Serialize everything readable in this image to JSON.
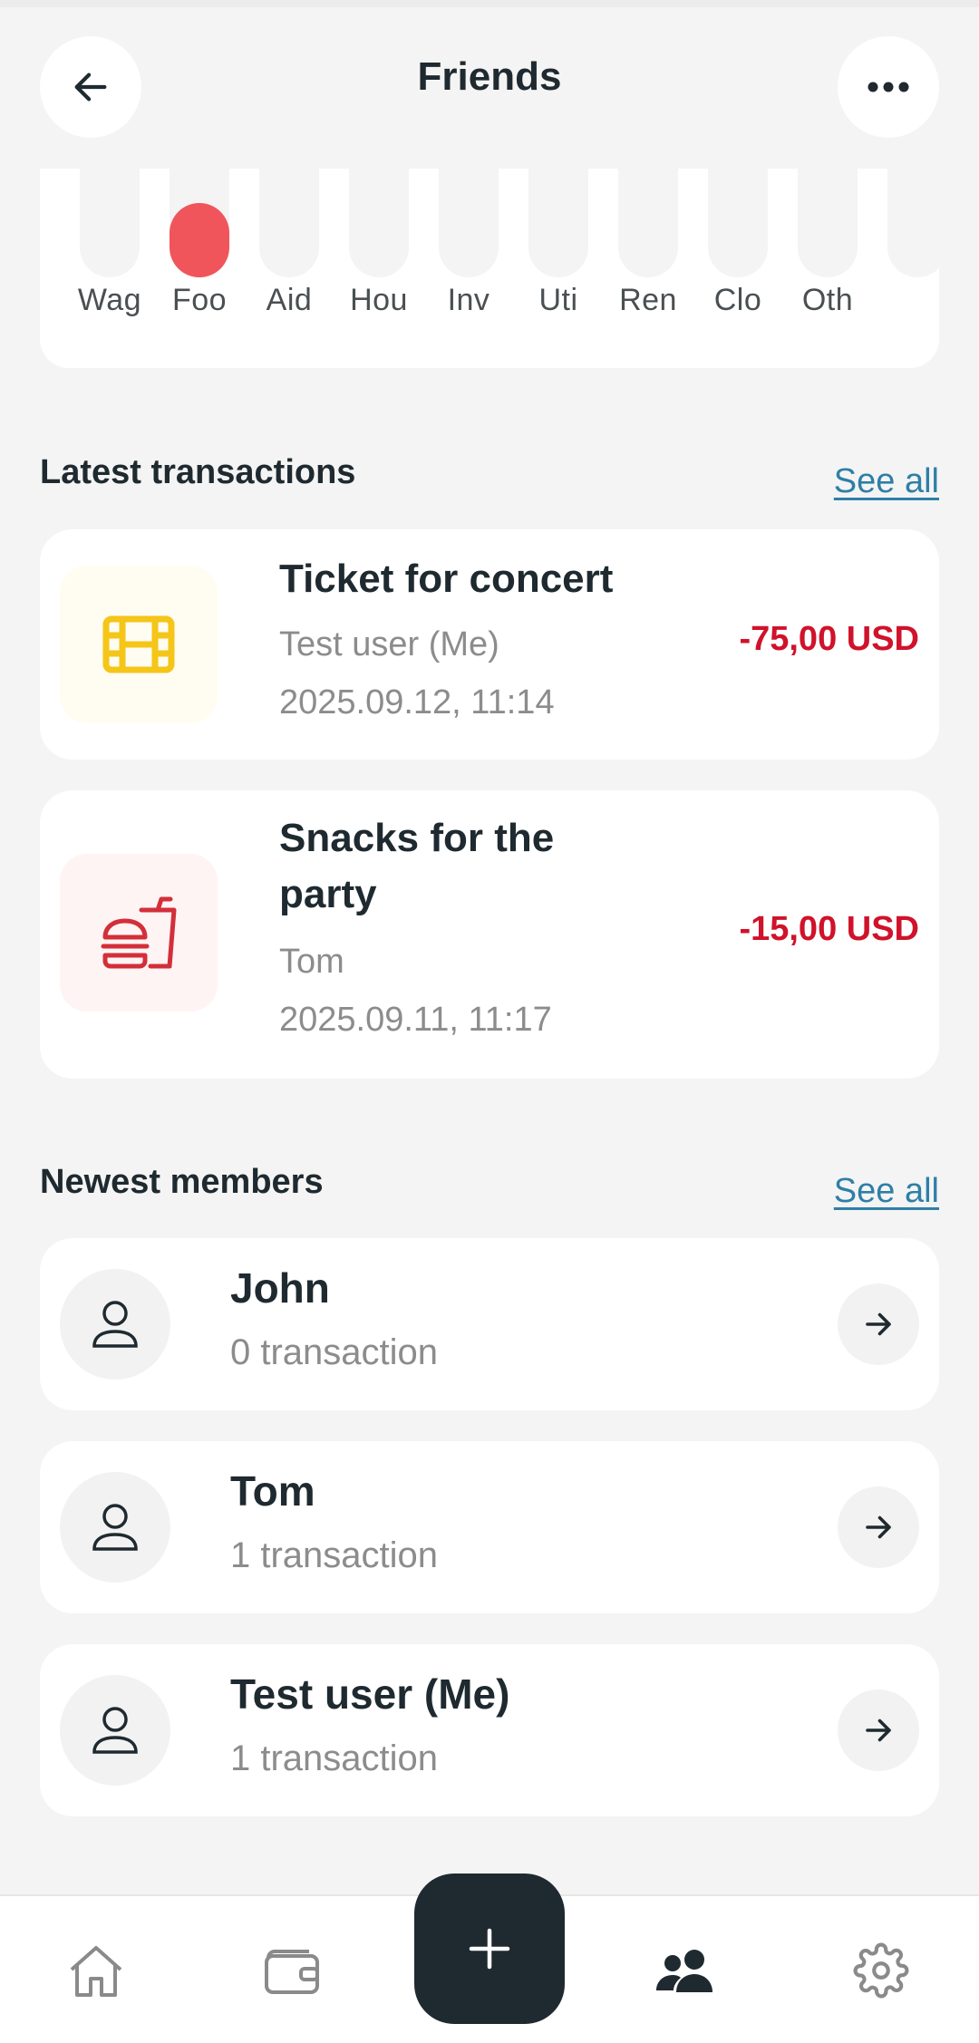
{
  "header": {
    "title": "Friends",
    "back_icon": "arrow-left-icon",
    "more_icon": "more-horizontal-icon"
  },
  "category_chart": {
    "categories": [
      "Wag",
      "Foo",
      "Aid",
      "Hou",
      "Inv",
      "Uti",
      "Ren",
      "Clo",
      "Oth"
    ],
    "values": [
      0,
      1,
      0,
      0,
      0,
      0,
      0,
      0,
      0
    ],
    "bar_color": "#f0555b"
  },
  "latest_transactions": {
    "title": "Latest transactions",
    "see_all": "See all",
    "items": [
      {
        "title": "Ticket for concert",
        "user": "Test user (Me)",
        "datetime": "2025.09.12, 11:14",
        "amount": "-75,00 USD",
        "icon": "film-icon",
        "icon_color": "#f5c518",
        "icon_bg": "#fffcf1"
      },
      {
        "title": "Snacks for the party",
        "user": "Tom",
        "datetime": "2025.09.11, 11:17",
        "amount": "-15,00 USD",
        "icon": "burger-drink-icon",
        "icon_color": "#d32f3a",
        "icon_bg": "#fff4f4"
      }
    ]
  },
  "newest_members": {
    "title": "Newest members",
    "see_all": "See all",
    "items": [
      {
        "name": "John",
        "count": "0 transaction"
      },
      {
        "name": "Tom",
        "count": "1 transaction"
      },
      {
        "name": "Test user (Me)",
        "count": "1 transaction"
      }
    ]
  },
  "bottom_nav": {
    "items": [
      "home-icon",
      "wallet-icon",
      "add-icon",
      "friends-icon",
      "settings-icon"
    ],
    "active": "friends-icon"
  },
  "colors": {
    "accent_dark": "#1f2a30",
    "negative": "#d0122b",
    "link": "#2e7fa6"
  }
}
